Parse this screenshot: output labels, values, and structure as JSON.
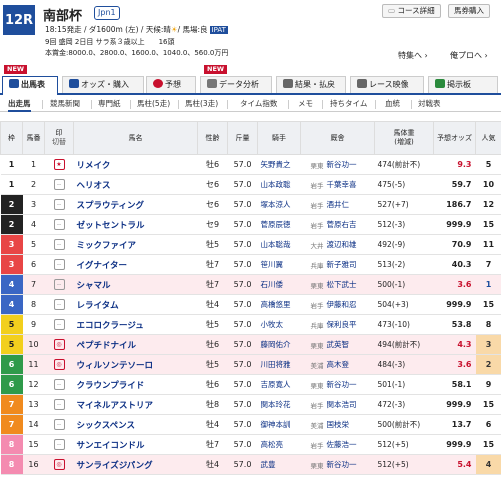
{
  "race": {
    "number": "12R",
    "name": "南部杯",
    "grade": "Jpn1",
    "line1": "18:15発走 / ダ1600m (左) / 天候:晴",
    "weather_icon": "sun-icon",
    "track": "/ 馬場:良",
    "ipat": "IPAT",
    "line2": "9回 盛岡 2日目 サラ系３歳以上　　16頭",
    "line3": "本賞金:8000.0、2800.0、1600.0、1040.0、560.0万円"
  },
  "header_buttons": [
    {
      "label": "コース詳細"
    },
    {
      "label": "馬券購入"
    }
  ],
  "links": [
    {
      "label": "特集へ ›"
    },
    {
      "label": "俺プロへ ›"
    }
  ],
  "new_label": "NEW",
  "tabs": [
    {
      "label": "出馬表",
      "color": "#1f4e9c"
    },
    {
      "label": "オッズ・購入",
      "color": "#1f4e9c"
    },
    {
      "label": "予想",
      "color": "#c8102e"
    },
    {
      "label": "データ分析",
      "color": "#666"
    },
    {
      "label": "結果・払戻",
      "color": "#555"
    },
    {
      "label": "レース映像",
      "color": "#555"
    },
    {
      "label": "掲示板",
      "color": "#2a8a3c"
    }
  ],
  "subtabs": [
    "出走馬",
    "競馬新聞",
    "専門紙",
    "馬柱(5走)",
    "馬柱(3走)",
    "タイム指数",
    "メモ",
    "持ちタイム",
    "血統",
    "対戦表"
  ],
  "columns": {
    "waku": "枠",
    "umaban": "馬番",
    "mark": "印",
    "mark_sub": "切替",
    "name": "馬名",
    "sex": "性齢",
    "weight": "斤量",
    "jockey": "騎手",
    "trainer": "厩舎",
    "bw": "馬体重",
    "bw_sub": "(増減)",
    "odds": "予想オッズ",
    "pop": "人気"
  },
  "waku_colors": {
    "1": {
      "bg": "#ffffff",
      "fg": "#222"
    },
    "2": {
      "bg": "#222222",
      "fg": "#fff"
    },
    "3": {
      "bg": "#e84545",
      "fg": "#fff"
    },
    "4": {
      "bg": "#3a66c4",
      "fg": "#fff"
    },
    "5": {
      "bg": "#f2cf1d",
      "fg": "#222"
    },
    "6": {
      "bg": "#2f9a4a",
      "fg": "#fff"
    },
    "7": {
      "bg": "#f08a1e",
      "fg": "#fff"
    },
    "8": {
      "bg": "#f48bb0",
      "fg": "#fff"
    }
  },
  "horses": [
    {
      "waku": "1",
      "num": "1",
      "mark": "★",
      "fav": true,
      "name": "リメイク",
      "sex": "牡6",
      "kg": "57.0",
      "jockey": "矢野貴之",
      "aff": "栗東",
      "trainer": "新谷功一",
      "bw": "474(前計不)",
      "odds": "9.3",
      "odds_red": true,
      "pop": "5",
      "pk": false
    },
    {
      "waku": "1",
      "num": "2",
      "mark": "--",
      "fav": false,
      "name": "ヘリオス",
      "sex": "セ6",
      "kg": "57.0",
      "jockey": "山本政聡",
      "aff": "岩手",
      "trainer": "千葉幸喜",
      "bw": "475(-5)",
      "odds": "59.7",
      "odds_red": false,
      "pop": "10",
      "pk": false
    },
    {
      "waku": "2",
      "num": "3",
      "mark": "--",
      "fav": false,
      "name": "スプラウティング",
      "sex": "セ6",
      "kg": "57.0",
      "jockey": "塚本涼人",
      "aff": "岩手",
      "trainer": "酒井仁",
      "bw": "527(+7)",
      "odds": "186.7",
      "odds_red": false,
      "pop": "12",
      "pk": false
    },
    {
      "waku": "2",
      "num": "4",
      "mark": "--",
      "fav": false,
      "name": "ゼットセントラル",
      "sex": "セ9",
      "kg": "57.0",
      "jockey": "菅原辰徳",
      "aff": "岩手",
      "trainer": "菅原右吉",
      "bw": "512(-3)",
      "odds": "999.9",
      "odds_red": false,
      "pop": "15",
      "pk": false
    },
    {
      "waku": "3",
      "num": "5",
      "mark": "--",
      "fav": false,
      "name": "ミックファイア",
      "sex": "牡5",
      "kg": "57.0",
      "jockey": "山本聡哉",
      "aff": "大井",
      "trainer": "渡辺和雄",
      "bw": "492(-9)",
      "odds": "70.9",
      "odds_red": false,
      "pop": "11",
      "pk": false
    },
    {
      "waku": "3",
      "num": "6",
      "mark": "--",
      "fav": false,
      "name": "イグナイター",
      "sex": "牡7",
      "kg": "57.0",
      "jockey": "笹川翼",
      "aff": "兵庫",
      "trainer": "新子雅司",
      "bw": "513(-2)",
      "odds": "40.3",
      "odds_red": false,
      "pop": "7",
      "pk": false
    },
    {
      "waku": "4",
      "num": "7",
      "mark": "--",
      "fav": false,
      "name": "シャマル",
      "sex": "牡7",
      "kg": "57.0",
      "jockey": "石川倭",
      "aff": "栗東",
      "trainer": "松下武士",
      "bw": "500(-1)",
      "odds": "3.6",
      "odds_red": true,
      "pop": "1",
      "pk": true
    },
    {
      "waku": "4",
      "num": "8",
      "mark": "--",
      "fav": false,
      "name": "レライタム",
      "sex": "牡4",
      "kg": "57.0",
      "jockey": "高橋悠里",
      "aff": "岩手",
      "trainer": "伊藤和忍",
      "bw": "504(+3)",
      "odds": "999.9",
      "odds_red": false,
      "pop": "15",
      "pk": false
    },
    {
      "waku": "5",
      "num": "9",
      "mark": "--",
      "fav": false,
      "name": "エコロクラージュ",
      "sex": "牡5",
      "kg": "57.0",
      "jockey": "小牧太",
      "aff": "兵庫",
      "trainer": "保利良平",
      "bw": "473(-10)",
      "odds": "53.8",
      "odds_red": false,
      "pop": "8",
      "pk": false
    },
    {
      "waku": "5",
      "num": "10",
      "mark": "◎",
      "fav": true,
      "name": "ペプチドナイル",
      "sex": "牡6",
      "kg": "57.0",
      "jockey": "藤岡佑介",
      "aff": "栗東",
      "trainer": "武英智",
      "bw": "494(前計不)",
      "odds": "4.3",
      "odds_red": true,
      "pop": "3",
      "pk": true
    },
    {
      "waku": "6",
      "num": "11",
      "mark": "◎",
      "fav": true,
      "name": "ウィルソンテソーロ",
      "sex": "牡5",
      "kg": "57.0",
      "jockey": "川田将雅",
      "aff": "美浦",
      "trainer": "高木登",
      "bw": "484(-3)",
      "odds": "3.6",
      "odds_red": true,
      "pop": "2",
      "pk": true
    },
    {
      "waku": "6",
      "num": "12",
      "mark": "--",
      "fav": false,
      "name": "クラウンプライド",
      "sex": "牡6",
      "kg": "57.0",
      "jockey": "吉原寛人",
      "aff": "栗東",
      "trainer": "新谷功一",
      "bw": "501(-1)",
      "odds": "58.1",
      "odds_red": false,
      "pop": "9",
      "pk": false
    },
    {
      "waku": "7",
      "num": "13",
      "mark": "--",
      "fav": false,
      "name": "マイネルアストリア",
      "sex": "牡8",
      "kg": "57.0",
      "jockey": "関本玲花",
      "aff": "岩手",
      "trainer": "関本浩司",
      "bw": "472(-3)",
      "odds": "999.9",
      "odds_red": false,
      "pop": "15",
      "pk": false
    },
    {
      "waku": "7",
      "num": "14",
      "mark": "--",
      "fav": false,
      "name": "シックスペンス",
      "sex": "牡4",
      "kg": "57.0",
      "jockey": "御神本訓",
      "aff": "美浦",
      "trainer": "国枝栄",
      "bw": "500(前計不)",
      "odds": "13.7",
      "odds_red": false,
      "pop": "6",
      "pk": false
    },
    {
      "waku": "8",
      "num": "15",
      "mark": "--",
      "fav": false,
      "name": "サンエイコンドル",
      "sex": "牡7",
      "kg": "57.0",
      "jockey": "高松亮",
      "aff": "岩手",
      "trainer": "佐藤浩一",
      "bw": "512(+5)",
      "odds": "999.9",
      "odds_red": false,
      "pop": "15",
      "pk": false
    },
    {
      "waku": "8",
      "num": "16",
      "mark": "◎",
      "fav": true,
      "name": "サンライズジパング",
      "sex": "牡4",
      "kg": "57.0",
      "jockey": "武豊",
      "aff": "栗東",
      "trainer": "新谷功一",
      "bw": "512(+5)",
      "odds": "5.4",
      "odds_red": true,
      "pop": "4",
      "pk": true
    }
  ]
}
